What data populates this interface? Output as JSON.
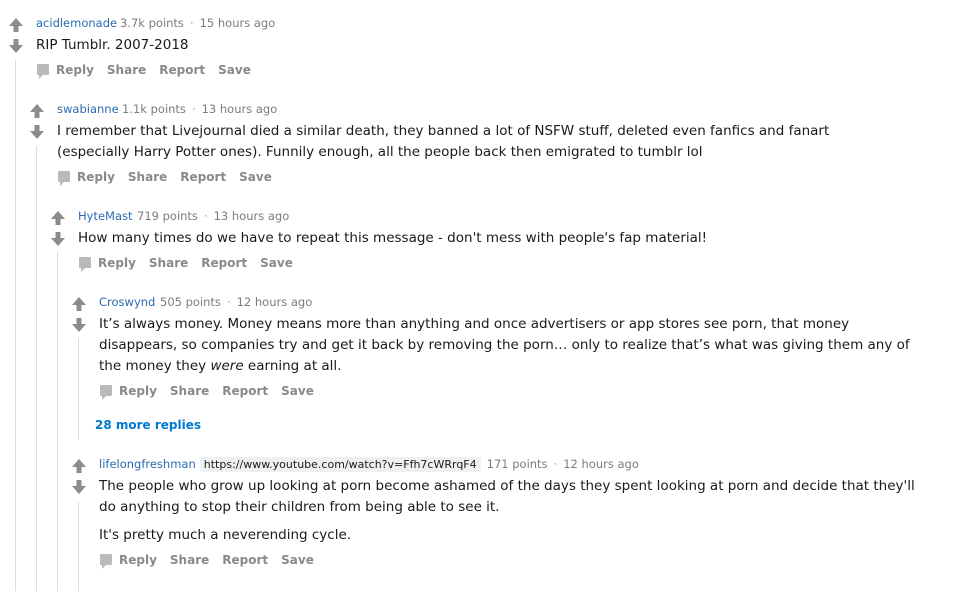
{
  "comments": [
    {
      "author": "acidlemonade",
      "points": "3.7k points",
      "time": "15 hours ago",
      "body": [
        "RIP Tumblr. 2007-2018"
      ]
    },
    {
      "author": "swabianne",
      "points": "1.1k points",
      "time": "13 hours ago",
      "body": [
        "I remember that Livejournal died a similar death, they banned a lot of NSFW stuff, deleted even fanfics and fanart",
        "(especially Harry Potter ones). Funnily enough, all the people back then emigrated to tumblr lol"
      ]
    },
    {
      "author": "HyteMast",
      "points": "719 points",
      "time": "13 hours ago",
      "body": [
        "How many times do we have to repeat this message - don't mess with people's fap material!"
      ]
    },
    {
      "author": "Croswynd",
      "points": "505 points",
      "time": "12 hours ago",
      "body": [
        "It’s always money. Money means more than anything and once advertisers or app stores see porn, that money",
        "disappears, so companies try and get it back by removing the porn… only to realize that’s what was giving them any of"
      ],
      "body_last_before": "the money they ",
      "body_last_em": "were",
      "body_last_after": " earning at all."
    },
    {
      "author": "lifelongfreshman",
      "flair": "https://www.youtube.com/watch?v=Ffh7cWRrqF4",
      "points": "171 points",
      "time": "12 hours ago",
      "body": [
        "The people who grow up looking at porn become ashamed of the days they spent looking at porn and decide that they'll",
        "do anything to stop their children from being able to see it."
      ],
      "body_p2": "It's pretty much a neverending cycle."
    }
  ],
  "actions": {
    "reply": "Reply",
    "share": "Share",
    "report": "Report",
    "save": "Save"
  },
  "more_replies": "28 more replies",
  "separator": "·",
  "icons": {
    "upvote": "upvote-arrow-icon",
    "downvote": "downvote-arrow-icon",
    "reply": "comment-bubble-icon"
  },
  "colors": {
    "author": "#2b6cb0",
    "meta": "#7c7c7c",
    "action": "#878a8c",
    "link": "#0079d3",
    "arrow": "#8a8c8e"
  }
}
